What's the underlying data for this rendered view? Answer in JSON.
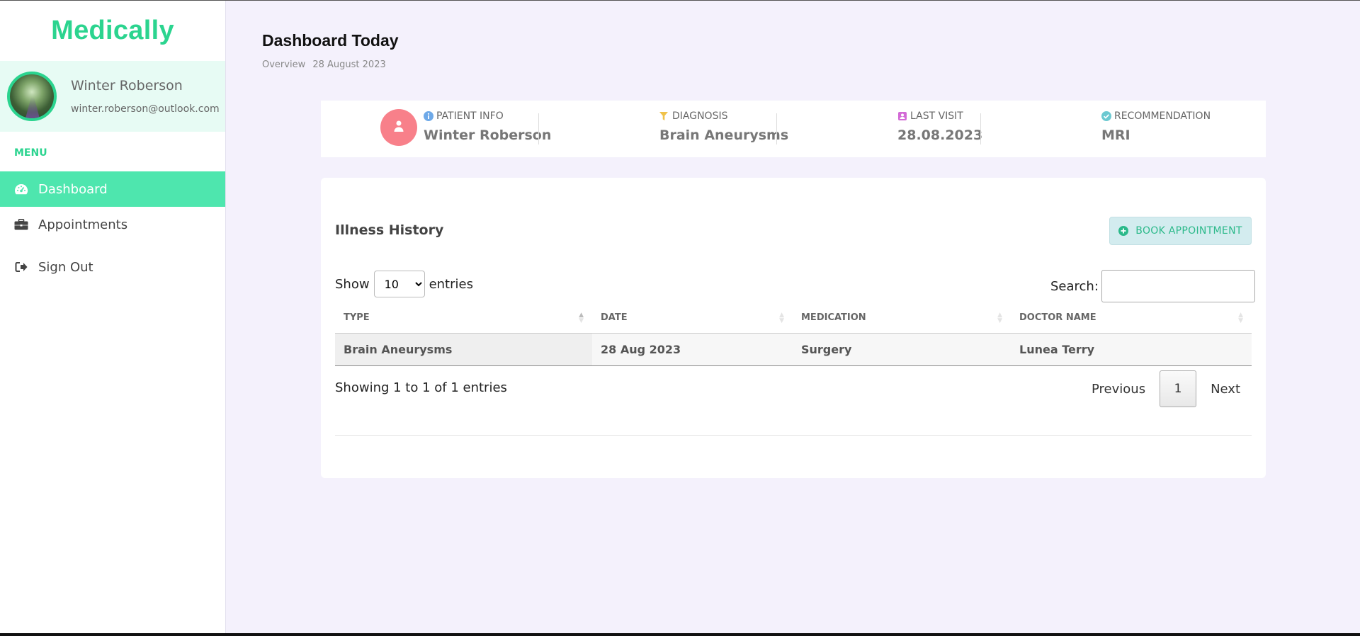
{
  "brand": "Medically",
  "profile": {
    "name": "Winter Roberson",
    "email": "winter.roberson@outlook.com"
  },
  "sidebar": {
    "menu_label": "MENU",
    "items": [
      {
        "label": "Dashboard",
        "icon": "dashboard-gauge-icon",
        "active": true
      },
      {
        "label": "Appointments",
        "icon": "briefcase-icon",
        "active": false
      },
      {
        "label": "Sign Out",
        "icon": "sign-out-icon",
        "active": false
      }
    ]
  },
  "header": {
    "title": "Dashboard Today",
    "crumb_overview": "Overview",
    "crumb_date": "28 August 2023"
  },
  "info": {
    "patient": {
      "label": "PATIENT INFO",
      "value": "Winter Roberson",
      "icon": "info-circle-icon"
    },
    "diagnosis": {
      "label": "DIAGNOSIS",
      "value": "Brain Aneurysms",
      "icon": "filter-icon"
    },
    "last_visit": {
      "label": "LAST VISIT",
      "value": "28.08.2023",
      "icon": "calendar-badge-icon"
    },
    "recommendation": {
      "label": "RECOMMENDATION",
      "value": "MRI",
      "icon": "check-circle-icon"
    }
  },
  "history": {
    "title": "Illness History",
    "book_label": "BOOK APPOINTMENT",
    "show_label": "Show",
    "entries_label": "entries",
    "page_size": "10",
    "search_label": "Search:",
    "search_value": "",
    "columns": [
      "TYPE",
      "DATE",
      "MEDICATION",
      "DOCTOR NAME"
    ],
    "rows": [
      [
        "Brain Aneurysms",
        "28 Aug 2023",
        "Surgery",
        "Lunea Terry"
      ]
    ],
    "showing_text": "Showing 1 to 1 of 1 entries",
    "prev_label": "Previous",
    "current_page": "1",
    "next_label": "Next"
  },
  "colors": {
    "accent": "#2bd48f",
    "active_nav": "#4ee6ae",
    "background": "#f4f1fc",
    "patient_avatar": "#f8808a"
  }
}
